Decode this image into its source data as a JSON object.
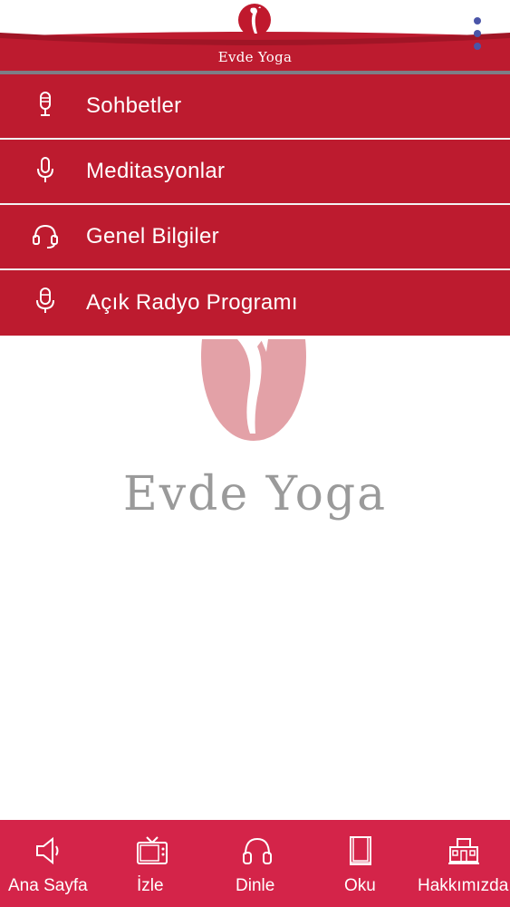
{
  "header": {
    "title": "Evde Yoga",
    "logo_icon": "yoga-figure-logo-icon",
    "menu_icon": "kebab-menu-icon"
  },
  "menu": {
    "items": [
      {
        "label": "Sohbetler",
        "icon": "microphone-icon"
      },
      {
        "label": "Meditasyonlar",
        "icon": "microphone-icon"
      },
      {
        "label": "Genel Bilgiler",
        "icon": "headset-icon"
      },
      {
        "label": "Açık Radyo Programı",
        "icon": "microphone-icon"
      }
    ]
  },
  "center": {
    "brand_text": "Evde Yoga"
  },
  "bottom_nav": {
    "items": [
      {
        "label": "Ana Sayfa",
        "icon": "speaker-icon"
      },
      {
        "label": "İzle",
        "icon": "tv-icon"
      },
      {
        "label": "Dinle",
        "icon": "headphones-icon"
      },
      {
        "label": "Oku",
        "icon": "book-icon"
      },
      {
        "label": "Hakkımızda",
        "icon": "building-icon"
      }
    ]
  },
  "colors": {
    "menu_red": "#bd1b2f",
    "nav_pink": "#d42449",
    "kebab_blue": "#4a55a8",
    "logo_pink": "#e3a1a7",
    "brand_gray": "#9a9a9a"
  }
}
